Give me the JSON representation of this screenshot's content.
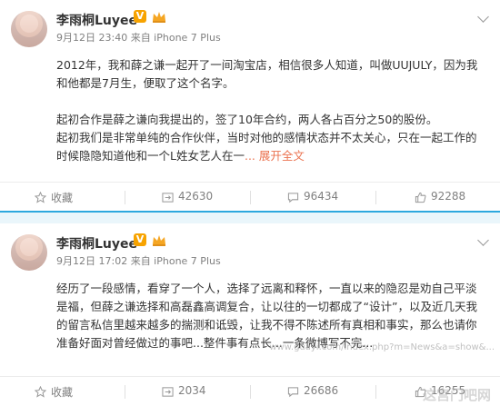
{
  "posts": [
    {
      "user": "李雨桐Luyee",
      "badge": "V",
      "meta": "9月12日 23:40 来自 iPhone 7 Plus",
      "paragraphs": [
        "2012年，我和薛之谦一起开了一间淘宝店，相信很多人知道，叫做UUJULY，因为我和他都是7月生，便取了这个名字。",
        "起初合作是薛之谦向我提出的，签了10年合约，两人各占百分之50的股份。",
        "起初我们是非常单纯的合作伙伴，当时对他的感情状态并不太关心，只在一起工作的时候隐隐知道他和一个L姓女艺人在一"
      ],
      "expand": "... 展开全文",
      "actions": {
        "fav": "收藏",
        "repost": "42630",
        "comment": "96434",
        "like": "92288"
      }
    },
    {
      "user": "李雨桐Luyee",
      "badge": "V",
      "meta": "9月12日 17:02 来自 iPhone 7 Plus",
      "paragraphs": [
        "经历了一段感情，看穿了一个人，选择了远离和释怀，一直以来的隐忍是劝自己平淡是福，但薛之谦选择和高磊鑫高调复合，让以往的一切都成了“设计”，以及近几天我的留言私信里越来越多的揣测和诋毁，让我不得不陈述所有真相和事实，那么也请你准备好面对曾经做过的事吧...整件事有点长...一条微博写不完..."
      ],
      "actions": {
        "fav": "收藏",
        "repost": "2034",
        "comment": "26686",
        "like": "16255"
      }
    }
  ],
  "watermarks": {
    "small": "www.guayi.com/index.php?m=News&a=show&...",
    "brand": "这宫门吧网"
  }
}
